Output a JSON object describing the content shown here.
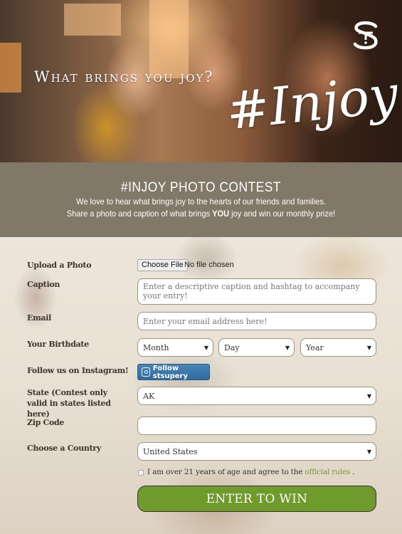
{
  "hero": {
    "tagline": "What brings you joy?",
    "hashtag": "#Injoy",
    "logo_text": "ST"
  },
  "banner": {
    "title": "#INJOY PHOTO CONTEST",
    "line1": "We love to hear what brings joy to the hearts of our friends and families.",
    "line2_before": "Share a photo and caption of what brings ",
    "line2_bold": "YOU",
    "line2_after": " joy and win our monthly prize!"
  },
  "form": {
    "upload": {
      "label": "Upload a Photo",
      "button": "Choose File",
      "status": "No file chosen"
    },
    "caption": {
      "label": "Caption",
      "placeholder": "Enter a descriptive caption and hashtag to accompany your entry!",
      "value": ""
    },
    "email": {
      "label": "Email",
      "placeholder": "Enter your email address here!",
      "value": ""
    },
    "birthdate": {
      "label": "Your Birthdate",
      "month": "Month",
      "day": "Day",
      "year": "Year"
    },
    "instagram": {
      "label": "Follow us on Instagram!",
      "button": "Follow stsupery",
      "icon": "instagram-icon"
    },
    "state": {
      "label": "State (Contest only valid in states listed here)",
      "selected": "AK"
    },
    "zip": {
      "label": "Zip Code",
      "value": ""
    },
    "country": {
      "label": "Choose a Country",
      "selected": "United States"
    },
    "agree": {
      "checked": false,
      "text_before": "I am over 21 years of age and agree to the ",
      "link": "official rules",
      "text_after": " ."
    },
    "submit": "ENTER TO WIN"
  },
  "colors": {
    "banner_bg": "#817868",
    "submit_bg": "#6f9a2c",
    "link": "#6e9a3a",
    "instagram_button": "#3a76aa"
  }
}
